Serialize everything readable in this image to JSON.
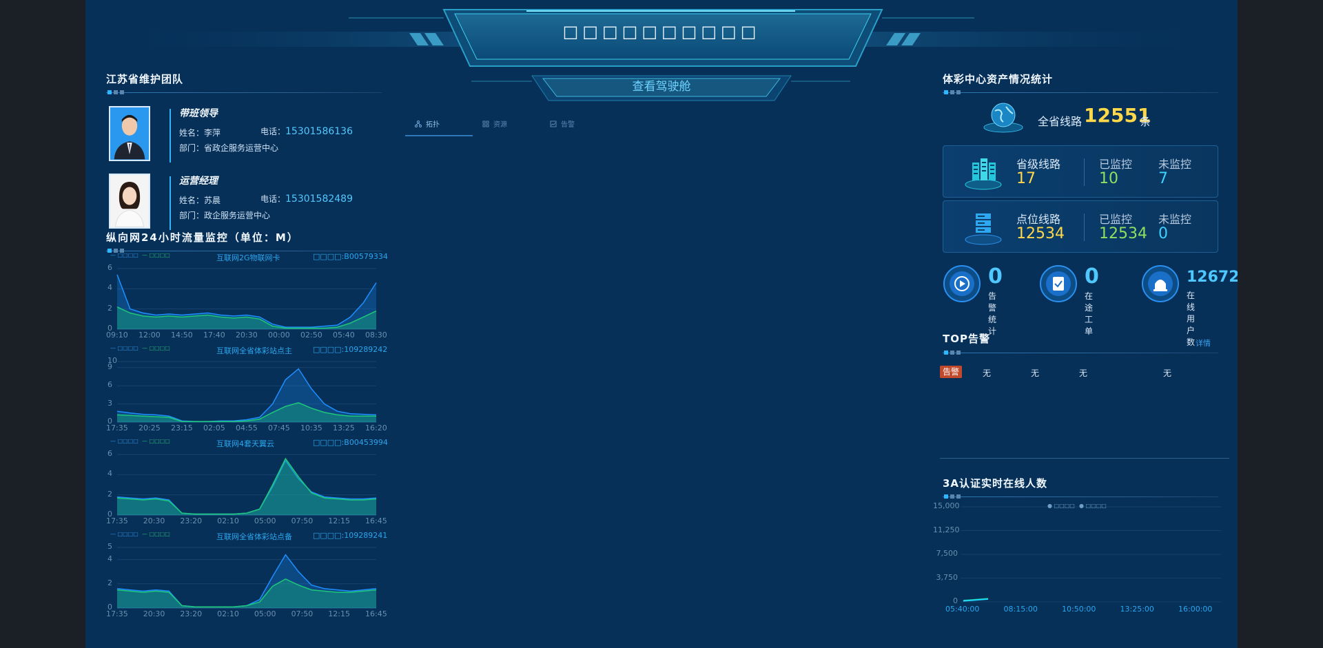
{
  "header": {
    "title": "□□□□□□□□□□",
    "cockpit_button": "查看驾驶舱"
  },
  "left": {
    "team_title": "江苏省维护团队",
    "people": [
      {
        "role": "带班领导",
        "name_label": "姓名：",
        "name": "李萍",
        "phone_label": "电话：",
        "phone": "15301586136",
        "dept_label": "部门：",
        "dept": "省政企服务运营中心"
      },
      {
        "role": "运营经理",
        "name_label": "姓名：",
        "name": "苏晨",
        "phone_label": "电话：",
        "phone": "15301582489",
        "dept_label": "部门：",
        "dept": "政企服务运营中心"
      }
    ],
    "traffic_title": "纵向网24小时流量监控（单位：M）"
  },
  "tabs": [
    "拓扑",
    "资源",
    "告警"
  ],
  "right": {
    "asset_title": "体彩中心资产情况统计",
    "total_label": "全省线路",
    "total_value": "12551",
    "total_unit": "条",
    "boxes": [
      {
        "label": "省级线路",
        "value": "17",
        "mon_label": "已监控",
        "mon_value": "10",
        "unmon_label": "未监控",
        "unmon_value": "7"
      },
      {
        "label": "点位线路",
        "value": "12534",
        "mon_label": "已监控",
        "mon_value": "12534",
        "unmon_label": "未监控",
        "unmon_value": "0"
      }
    ],
    "minis": [
      {
        "value": "0",
        "label": "告警统计"
      },
      {
        "value": "0",
        "label": "在途工单"
      },
      {
        "value": "12672",
        "label": "在线用户数"
      }
    ],
    "top_title": "TOP告警",
    "detail": "详情",
    "alarm_tag": "告警",
    "alarm_cells": [
      "无",
      "无",
      "无",
      "无"
    ],
    "online_title": "3A认证实时在线人数"
  },
  "colors": {
    "inflow": "#1e8fff",
    "outflow": "#1ec77a",
    "accent": "#2fb6ff",
    "gold": "#ffd84a"
  },
  "chart_data": [
    {
      "type": "area",
      "title": "互联网2G物联网卡",
      "id_label": "□□□□:B00579334",
      "legend": [
        "□□□□",
        "□□□□"
      ],
      "x": [
        "09:10",
        "12:00",
        "14:50",
        "17:40",
        "20:30",
        "00:00",
        "02:50",
        "05:40",
        "08:30"
      ],
      "yticks": [
        0,
        2,
        4,
        6
      ],
      "ylim": [
        0,
        6
      ],
      "series": [
        {
          "name": "□□□□",
          "values": [
            5.4,
            2.0,
            1.6,
            1.4,
            1.5,
            1.4,
            1.5,
            1.6,
            1.4,
            1.3,
            1.4,
            1.2,
            0.5,
            0.2,
            0.2,
            0.2,
            0.3,
            0.4,
            1.2,
            2.6,
            4.6
          ]
        },
        {
          "name": "□□□□",
          "values": [
            2.2,
            1.6,
            1.3,
            1.2,
            1.3,
            1.2,
            1.3,
            1.4,
            1.2,
            1.1,
            1.2,
            1.0,
            0.3,
            0.1,
            0.1,
            0.1,
            0.1,
            0.2,
            0.6,
            1.2,
            1.8
          ]
        }
      ]
    },
    {
      "type": "area",
      "title": "互联网全省体彩站点主",
      "id_label": "□□□□:109289242",
      "legend": [
        "□□□□",
        "□□□□"
      ],
      "x": [
        "17:35",
        "20:25",
        "23:15",
        "02:05",
        "04:55",
        "07:45",
        "10:35",
        "13:25",
        "16:20"
      ],
      "yticks": [
        0,
        3,
        6,
        9,
        10
      ],
      "ylim": [
        0,
        10
      ],
      "series": [
        {
          "name": "□□□□",
          "values": [
            1.8,
            1.5,
            1.3,
            1.2,
            1.0,
            0.2,
            0.1,
            0.1,
            0.2,
            0.2,
            0.4,
            0.8,
            3.0,
            7.0,
            8.8,
            5.5,
            3.0,
            1.8,
            1.4,
            1.3,
            1.2
          ]
        },
        {
          "name": "□□□□",
          "values": [
            1.2,
            1.1,
            1.0,
            0.9,
            0.8,
            0.1,
            0.1,
            0.1,
            0.1,
            0.1,
            0.2,
            0.5,
            1.6,
            2.6,
            3.2,
            2.3,
            1.6,
            1.2,
            1.0,
            1.0,
            1.0
          ]
        }
      ]
    },
    {
      "type": "area",
      "title": "互联网4套天翼云",
      "id_label": "□□□□:B00453994",
      "legend": [
        "□□□□",
        "□□□□"
      ],
      "x": [
        "17:35",
        "20:30",
        "23:20",
        "02:10",
        "05:00",
        "07:50",
        "12:15",
        "16:45"
      ],
      "yticks": [
        0,
        2,
        4,
        6
      ],
      "ylim": [
        0,
        6
      ],
      "series": [
        {
          "name": "□□□□",
          "values": [
            1.8,
            1.7,
            1.6,
            1.7,
            1.5,
            0.2,
            0.1,
            0.1,
            0.1,
            0.1,
            0.2,
            0.6,
            2.8,
            5.4,
            3.6,
            2.3,
            1.8,
            1.7,
            1.6,
            1.6,
            1.7
          ]
        },
        {
          "name": "□□□□",
          "values": [
            1.7,
            1.6,
            1.5,
            1.6,
            1.4,
            0.2,
            0.1,
            0.1,
            0.1,
            0.1,
            0.2,
            0.6,
            3.0,
            5.6,
            3.8,
            2.2,
            1.7,
            1.6,
            1.5,
            1.5,
            1.6
          ]
        }
      ]
    },
    {
      "type": "area",
      "title": "互联网全省体彩站点备",
      "id_label": "□□□□:109289241",
      "legend": [
        "□□□□",
        "□□□□"
      ],
      "x": [
        "17:35",
        "20:30",
        "23:20",
        "02:10",
        "05:00",
        "07:50",
        "12:15",
        "16:45"
      ],
      "yticks": [
        0,
        2,
        4,
        5
      ],
      "ylim": [
        0,
        5
      ],
      "series": [
        {
          "name": "□□□□",
          "values": [
            1.6,
            1.5,
            1.4,
            1.5,
            1.4,
            0.2,
            0.1,
            0.1,
            0.1,
            0.1,
            0.2,
            0.7,
            2.6,
            4.4,
            3.0,
            1.9,
            1.6,
            1.5,
            1.4,
            1.5,
            1.6
          ]
        },
        {
          "name": "□□□□",
          "values": [
            1.5,
            1.4,
            1.3,
            1.4,
            1.3,
            0.2,
            0.1,
            0.1,
            0.1,
            0.1,
            0.2,
            0.5,
            1.8,
            2.4,
            1.9,
            1.5,
            1.4,
            1.3,
            1.3,
            1.4,
            1.5
          ]
        }
      ]
    },
    {
      "type": "line",
      "title": "3A认证实时在线人数",
      "legend": [
        "□□□□",
        "□□□□"
      ],
      "x": [
        "05:40:00",
        "08:15:00",
        "10:50:00",
        "13:25:00",
        "16:00:00"
      ],
      "yticks": [
        "0",
        "3,750",
        "7,500",
        "11,250",
        "15,000"
      ],
      "ylim": [
        0,
        15000
      ],
      "series": [
        {
          "name": "□□□□",
          "values": [
            200,
            350,
            500
          ]
        },
        {
          "name": "□□□□",
          "values": [
            150,
            300,
            450
          ]
        }
      ]
    }
  ]
}
